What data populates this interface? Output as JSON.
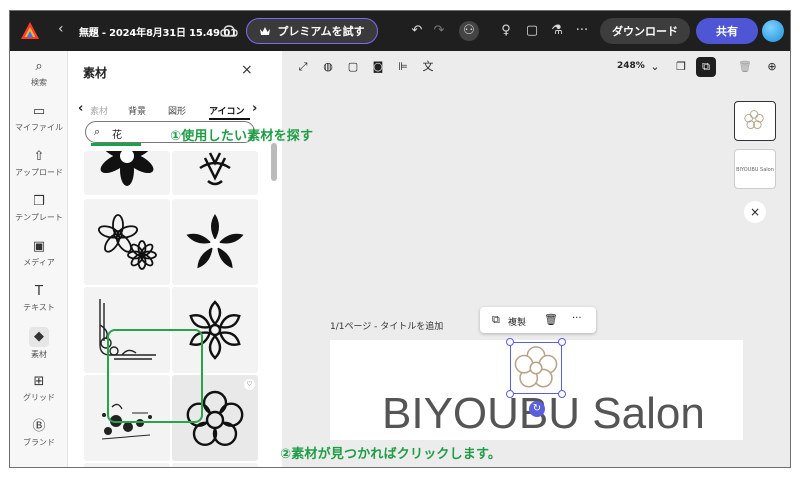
{
  "topbar": {
    "back_glyph": "‹",
    "doc_title": "無題 - 2024年8月31日 15.49.01",
    "premium_label": "プレミアムを試す",
    "download_label": "ダウンロード",
    "share_label": "共有"
  },
  "rail": {
    "items": [
      {
        "label": "検索",
        "icon": "⌕"
      },
      {
        "label": "マイファイル",
        "icon": "▭"
      },
      {
        "label": "アップロード",
        "icon": "⇧"
      },
      {
        "label": "テンプレート",
        "icon": "❒"
      },
      {
        "label": "メディア",
        "icon": "▣"
      },
      {
        "label": "テキスト",
        "icon": "T"
      },
      {
        "label": "素材",
        "icon": "◆"
      },
      {
        "label": "グリッド",
        "icon": "⊞"
      },
      {
        "label": "ブランド",
        "icon": "Ⓑ"
      }
    ]
  },
  "panel": {
    "title": "素材",
    "close_glyph": "×",
    "tabs": [
      "素材",
      "背景",
      "図形",
      "アイコン"
    ],
    "search_value": "花"
  },
  "annotations": {
    "step1": "①使用したい素材を探す",
    "step2": "②素材が見つかればクリックします。"
  },
  "canvas": {
    "zoom": "248%",
    "page_label": "1/1ページ - タイトルを追加",
    "ctx_duplicate": "複製",
    "ctx_more": "···",
    "brand_text": "BIYOUBU Salon",
    "thumb2_text": "BIYOUBU Salon",
    "close_glyph": "×"
  },
  "colors": {
    "accent_green": "#1f9d45",
    "share_blue": "#4e56d6",
    "selection_blue": "#5b5fdc"
  }
}
